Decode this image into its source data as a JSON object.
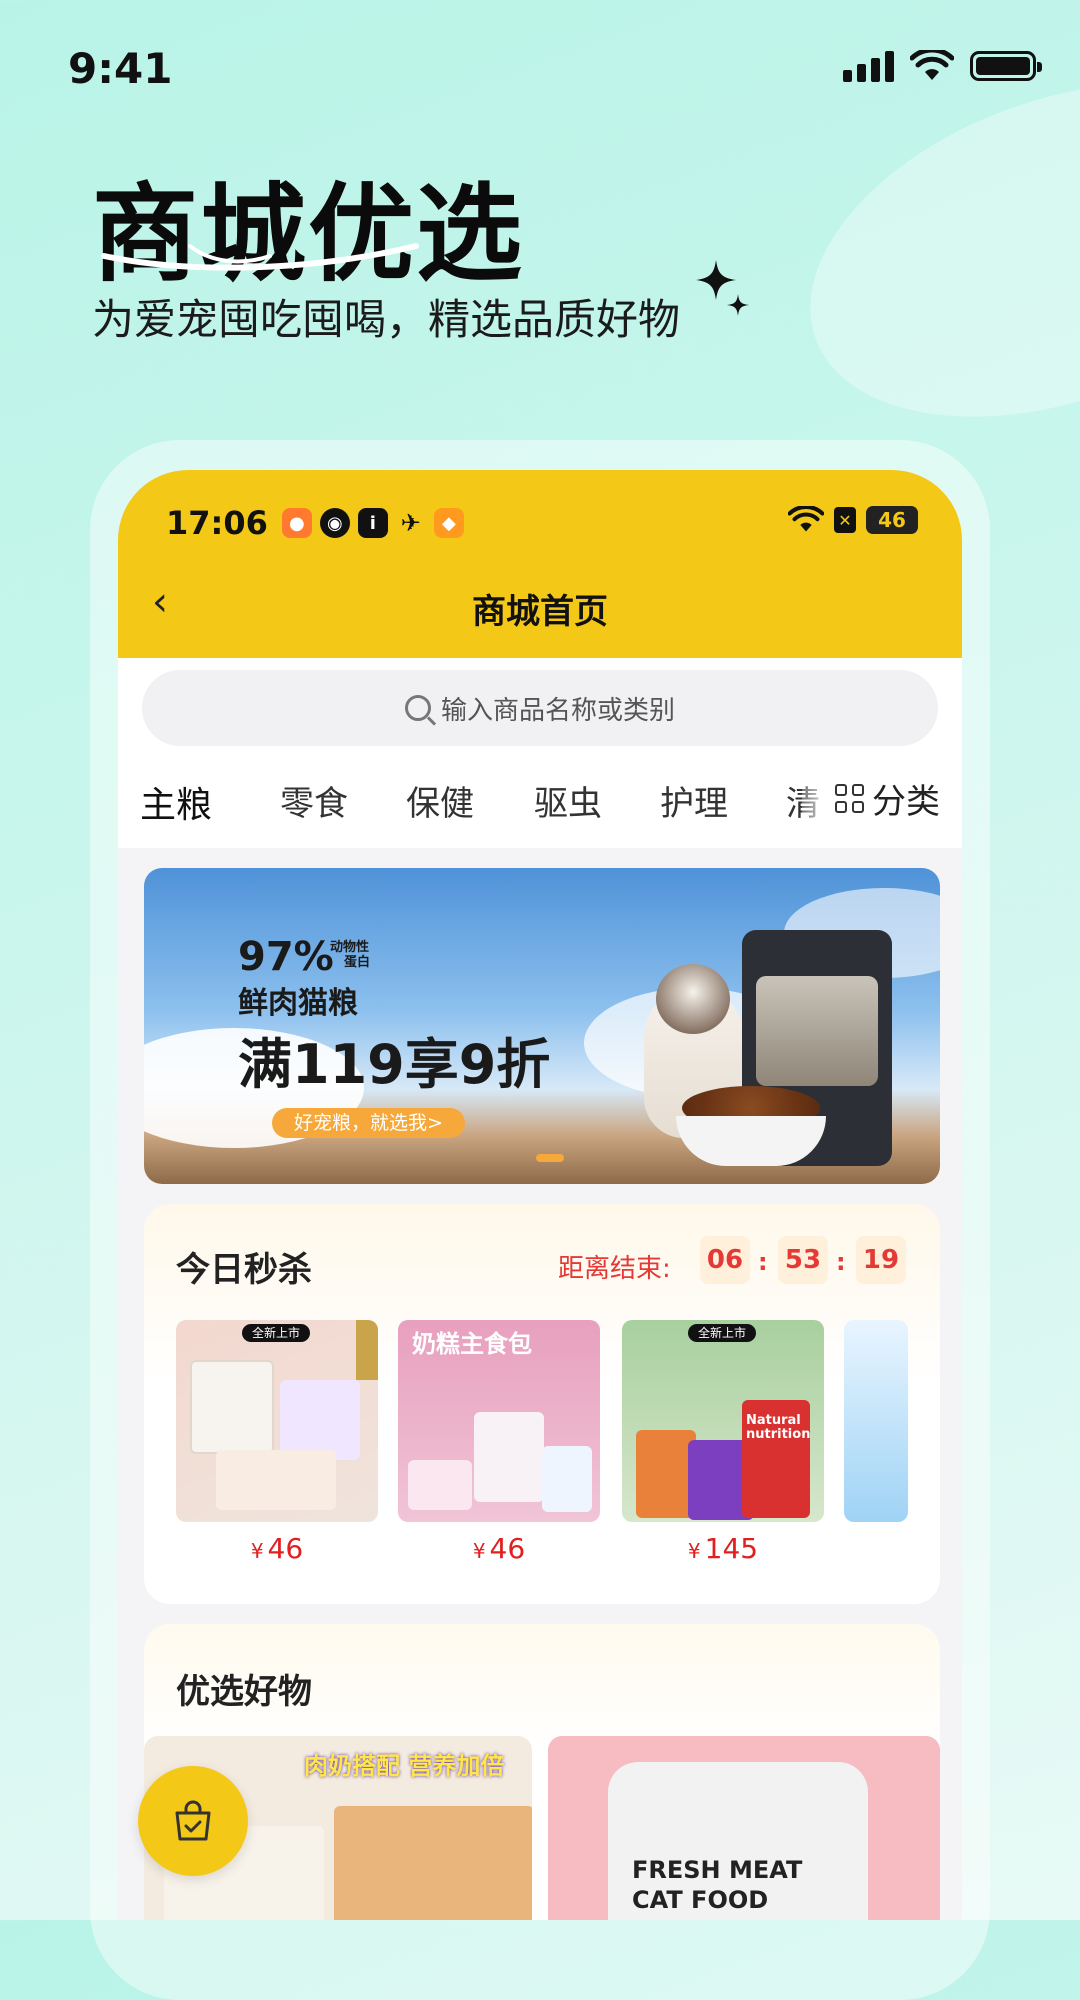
{
  "os_status": {
    "time": "9:41"
  },
  "hero": {
    "title": "商城优选",
    "subtitle": "为爱宠囤吃囤喝，精选品质好物"
  },
  "app": {
    "status": {
      "time": "17:06",
      "battery": "46"
    },
    "nav": {
      "title": "商城首页"
    },
    "search": {
      "placeholder": "输入商品名称或类别"
    },
    "categories": [
      "主粮",
      "零食",
      "保健",
      "驱虫",
      "护理",
      "清"
    ],
    "category_all": "分类",
    "banner": {
      "percent": "97%",
      "percent_note_1": "动物性",
      "percent_note_2": "蛋白",
      "line2": "鲜肉猫粮",
      "line3": "满119享9折",
      "button": "好宠粮，就选我>"
    },
    "flash_sale": {
      "title": "今日秒杀",
      "countdown_label": "距离结束:",
      "hours": "06",
      "minutes": "53",
      "seconds": "19",
      "currency": "¥",
      "products": [
        {
          "tag": "全新上市",
          "price": "46"
        },
        {
          "tag": "",
          "price": "46",
          "img_text": "奶糕主食包"
        },
        {
          "tag": "全新上市",
          "price": "145",
          "img_text": "Natural nutrition"
        }
      ]
    },
    "featured": {
      "title": "优选好物",
      "left_card_text": "肉奶搭配 营养加倍",
      "right_card_text_1": "FRESH MEAT",
      "right_card_text_2": "CAT FOOD"
    }
  },
  "colors": {
    "brand_yellow": "#f4c817",
    "price_red": "#e02020",
    "bg_mint": "#c7f6ec"
  }
}
